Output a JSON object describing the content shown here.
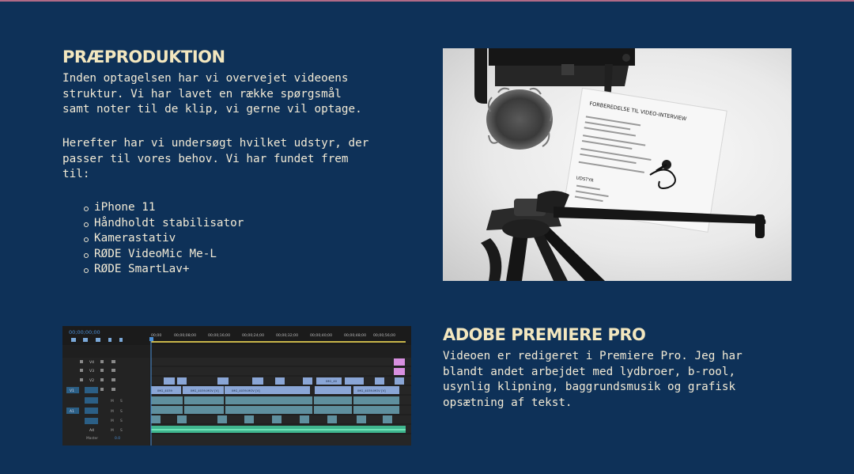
{
  "preproduction": {
    "heading": "PRÆPRODUKTION",
    "intro": "Inden optagelsen har vi overvejet videoens\nstruktur. Vi har lavet en række spørgsmål\nsamt noter til de klip, vi gerne vil optage.",
    "equipment_intro": "Herefter har vi undersøgt hvilket udstyr, der\npasser til vores behov. Vi har fundet frem\ntil:",
    "equipment": [
      "iPhone 11",
      "Håndholdt stabilisator",
      "Kamerastativ",
      "RØDE VideoMic Me-L",
      "RØDE SmartLav+"
    ]
  },
  "photo": {
    "paper_title": "FORBEREDELSE TIL VIDEO-INTERVIEW",
    "paper_section": "UDSTYR"
  },
  "premiere": {
    "heading": "ADOBE PREMIERE PRO",
    "text": "Videoen er redigeret i Premiere Pro. Jeg har\nblandt andet arbejdet med lydbroer, b-rool,\nusynlig klipning, baggrundsmusik og grafisk\nopsætning af tekst."
  },
  "timeline": {
    "timecode": "00;00;00;00",
    "ruler": [
      "00;00",
      "00;00;08;00",
      "00;00;16;00",
      "00;00;24;00",
      "00;00;32;00",
      "00;00;40;00",
      "00;00;48;00",
      "00;00;56;00"
    ],
    "video_tracks": [
      "V4",
      "V3",
      "V2",
      "V1"
    ],
    "audio_tracks": [
      "A1",
      "A2",
      "A3",
      "A4"
    ],
    "source_v": "V1",
    "source_a": "A1",
    "track_m": "M",
    "track_s": "S",
    "master_label": "Master",
    "master_value": "0.0",
    "clips": [
      "IMG_4039",
      "IMG_4039.MOV [V]",
      "IMG_4039.MOV [V]",
      "IMG_40",
      "IMG_4039.MOV [V]"
    ],
    "colors": {
      "video_clip": "#8aa6d6",
      "audio_clip": "#5f8f9e",
      "music": "#3fb58e",
      "title": "#d88fe0",
      "playhead": "#4a8fd6",
      "work_area": "#c8b54a"
    }
  },
  "colors": {
    "background": "#0e3158",
    "heading": "#f3e7bf",
    "text": "#f2ead5"
  }
}
